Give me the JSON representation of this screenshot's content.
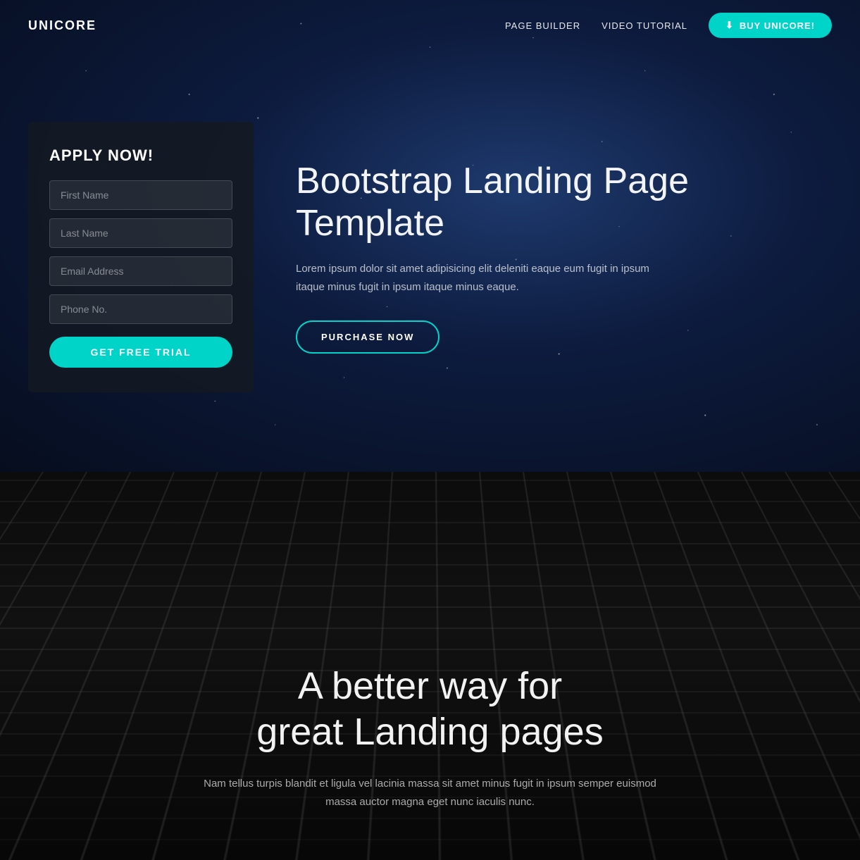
{
  "nav": {
    "logo": "UNICORE",
    "links": [
      {
        "label": "PAGE BUILDER",
        "href": "#"
      },
      {
        "label": "VIDEO TUTORIAL",
        "href": "#"
      }
    ],
    "cta": {
      "icon": "⬇",
      "label": "BUY UNICORE!"
    }
  },
  "hero": {
    "form": {
      "title": "APPLY NOW!",
      "fields": [
        {
          "placeholder": "First Name",
          "type": "text",
          "name": "first-name"
        },
        {
          "placeholder": "Last Name",
          "type": "text",
          "name": "last-name"
        },
        {
          "placeholder": "Email Address",
          "type": "email",
          "name": "email"
        },
        {
          "placeholder": "Phone No.",
          "type": "tel",
          "name": "phone"
        }
      ],
      "button": "GET FREE TRIAL"
    },
    "heading": "Bootstrap Landing Page Template",
    "description": "Lorem ipsum dolor sit amet adipisicing elit deleniti eaque eum fugit in ipsum itaque minus fugit in ipsum itaque minus eaque.",
    "cta": "PURCHASE NOW"
  },
  "section2": {
    "heading_line1": "A better way for",
    "heading_line2": "great Landing pages",
    "description": "Nam tellus turpis blandit et ligula vel lacinia massa sit amet minus fugit in ipsum semper euismod massa auctor magna eget nunc iaculis nunc."
  }
}
